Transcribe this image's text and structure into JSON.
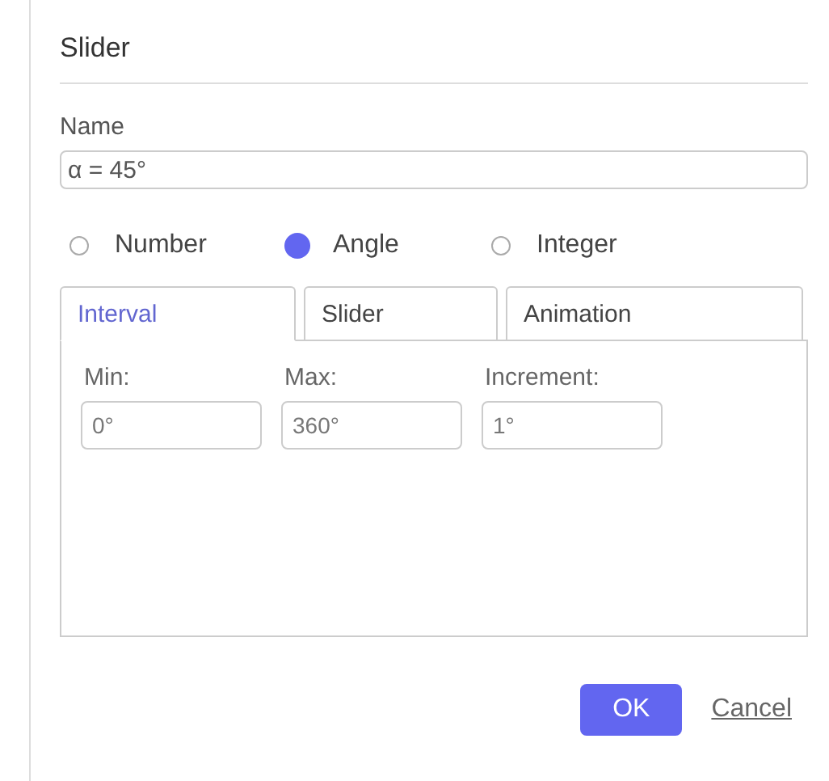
{
  "dialog": {
    "title": "Slider"
  },
  "name_field": {
    "label": "Name",
    "value": "α = 45°"
  },
  "types": [
    {
      "label": "Number",
      "selected": false
    },
    {
      "label": "Angle",
      "selected": true
    },
    {
      "label": "Integer",
      "selected": false
    }
  ],
  "tabs": [
    {
      "label": "Interval",
      "selected": true
    },
    {
      "label": "Slider",
      "selected": false
    },
    {
      "label": "Animation",
      "selected": false
    }
  ],
  "interval_fields": [
    {
      "label": "Min:",
      "value": "0°"
    },
    {
      "label": "Max:",
      "value": "360°"
    },
    {
      "label": "Increment:",
      "value": "1°"
    }
  ],
  "buttons": [
    {
      "kind": "primary",
      "label": "OK"
    },
    {
      "kind": "link",
      "label": "Cancel"
    }
  ]
}
